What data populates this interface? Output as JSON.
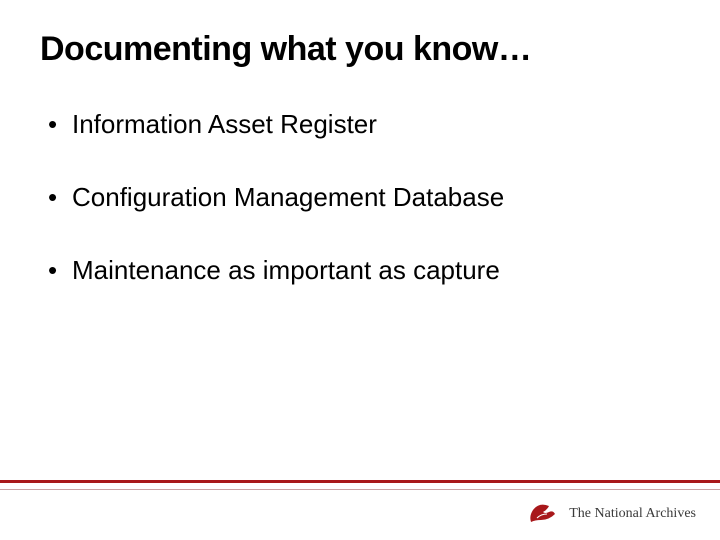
{
  "slide": {
    "title": "Documenting what you know…",
    "bullets": [
      "Information Asset Register",
      "Configuration Management Database",
      "Maintenance as important as capture"
    ]
  },
  "footer": {
    "logo_text": "The National Archives",
    "accent_color": "#a8181b"
  }
}
